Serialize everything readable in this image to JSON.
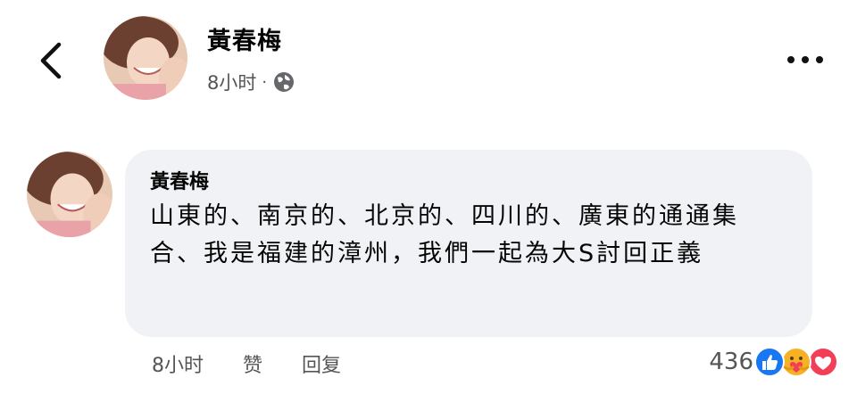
{
  "post": {
    "author": "黃春梅",
    "time": "8小时",
    "separator": "·",
    "audience_icon": "globe-icon",
    "more_icon": "more-dots-icon",
    "back_icon": "chevron-left-icon"
  },
  "comment": {
    "author": "黃春梅",
    "text": "山東的、南京的、北京的、四川的、廣東的通通集合、我是福建的漳州，我們一起為大S討回正義",
    "time": "8小时",
    "like_label": "赞",
    "reply_label": "回复",
    "reaction_count": "436",
    "reactions": [
      "like-icon",
      "care-icon",
      "love-icon"
    ]
  },
  "colors": {
    "bubble": "#f0f2f5",
    "like": "#1877f2",
    "love": "#f33e58",
    "care": "#f7b125"
  }
}
